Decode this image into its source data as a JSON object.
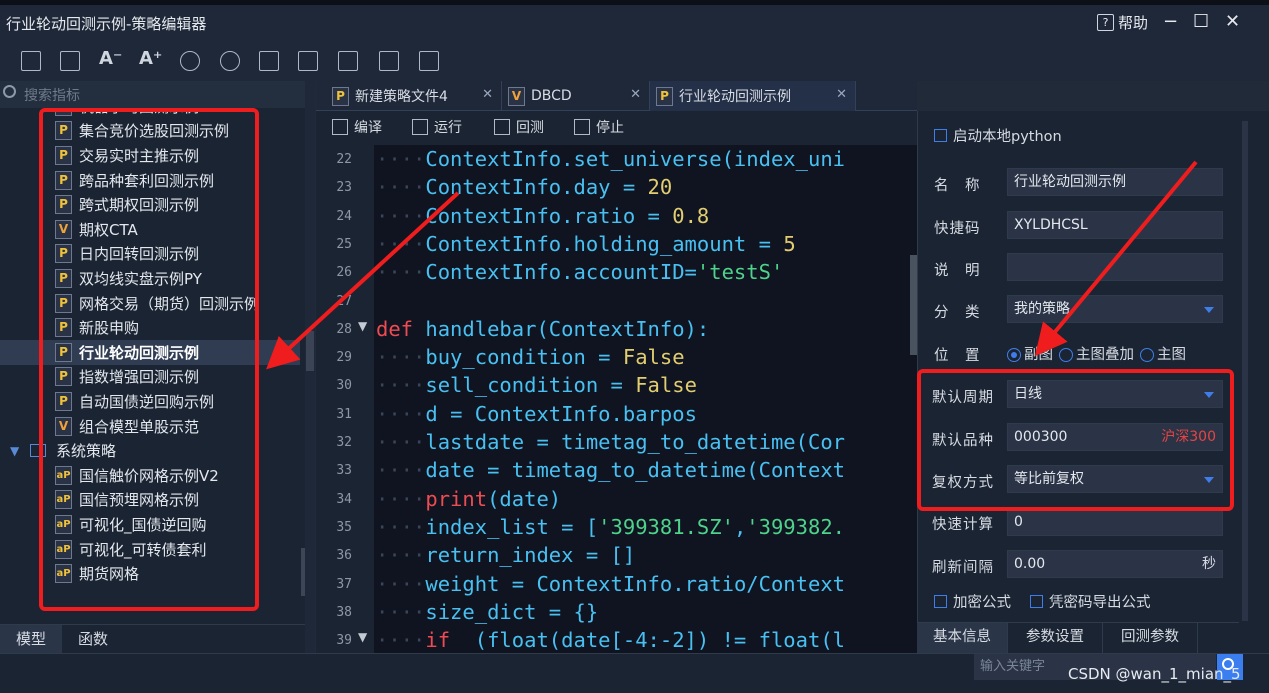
{
  "window": {
    "title": "行业轮动回测示例-策略编辑器",
    "help_icon_text": "?",
    "help_label": "帮助",
    "minimize": "−",
    "maximize": "☐",
    "close": "✕"
  },
  "toolbar": {
    "icons": [
      "save-icon",
      "save-all-icon",
      "font-decrease-icon",
      "font-increase-icon",
      "import-icon",
      "export-icon",
      "search-file-icon",
      "document-icon",
      "list-document-icon",
      "encrypt-icon",
      "decrypt-icon"
    ],
    "font_decrease": "A⁻",
    "font_increase": "A⁺"
  },
  "left": {
    "search_placeholder": "搜索指标",
    "items": [
      {
        "icon": "P",
        "label": "机器学习回测示例"
      },
      {
        "icon": "P",
        "label": "集合竞价选股回测示例"
      },
      {
        "icon": "P",
        "label": "交易实时主推示例"
      },
      {
        "icon": "P",
        "label": "跨品种套利回测示例"
      },
      {
        "icon": "P",
        "label": "跨式期权回测示例"
      },
      {
        "icon": "V",
        "label": "期权CTA"
      },
      {
        "icon": "P",
        "label": "日内回转回测示例"
      },
      {
        "icon": "P",
        "label": "双均线实盘示例PY"
      },
      {
        "icon": "P",
        "label": "网格交易（期货）回测示例"
      },
      {
        "icon": "P",
        "label": "新股申购"
      },
      {
        "icon": "P",
        "label": "行业轮动回测示例"
      },
      {
        "icon": "P",
        "label": "指数增强回测示例"
      },
      {
        "icon": "P",
        "label": "自动国债逆回购示例"
      },
      {
        "icon": "V",
        "label": "组合模型单股示范"
      }
    ],
    "folder": "系统策略",
    "folder_items": [
      {
        "icon": "aP",
        "label": "国信触价网格示例V2"
      },
      {
        "icon": "aP",
        "label": "国信预埋网格示例"
      },
      {
        "icon": "aP",
        "label": "可视化_国债逆回购"
      },
      {
        "icon": "aP",
        "label": "可视化_可转债套利"
      },
      {
        "icon": "aP",
        "label": "期货网格"
      }
    ],
    "tabs": [
      "模型",
      "函数"
    ]
  },
  "tabs": [
    {
      "icon": "P",
      "label": "新建策略文件4",
      "close": "✕"
    },
    {
      "icon": "V",
      "label": "DBCD",
      "close": "✕"
    },
    {
      "icon": "P",
      "label": "行业轮动回测示例",
      "close": "✕"
    }
  ],
  "code_toolbar": {
    "compile": "编译",
    "run": "运行",
    "backtest": "回测",
    "stop": "停止"
  },
  "code_lines": [
    {
      "n": "22",
      "html": "<span class='dot'>····</span>ContextInfo.set_universe(index_uni"
    },
    {
      "n": "23",
      "html": "<span class='dot'>····</span>ContextInfo.day <span class='op'>=</span> <span class='num'>20</span>"
    },
    {
      "n": "24",
      "html": "<span class='dot'>····</span>ContextInfo.ratio <span class='op'>=</span> <span class='num'>0.8</span>"
    },
    {
      "n": "25",
      "html": "<span class='dot'>····</span>ContextInfo.holding_amount <span class='op'>=</span> <span class='num'>5</span>"
    },
    {
      "n": "26",
      "html": "<span class='dot'>····</span>ContextInfo.accountID=<span class='str'>'testS'</span>"
    },
    {
      "n": "27",
      "html": ""
    },
    {
      "n": "28",
      "fold": "▼",
      "html": "<span class='kw'>def</span> handlebar(ContextInfo):"
    },
    {
      "n": "29",
      "html": "<span class='dot'>····</span>buy_condition <span class='op'>=</span> <span class='num'>False</span>"
    },
    {
      "n": "30",
      "html": "<span class='dot'>····</span>sell_condition <span class='op'>=</span> <span class='num'>False</span>"
    },
    {
      "n": "31",
      "html": "<span class='dot'>····</span>d <span class='op'>=</span> ContextInfo.barpos"
    },
    {
      "n": "32",
      "html": "<span class='dot'>····</span>lastdate <span class='op'>=</span> timetag_to_datetime(Cor"
    },
    {
      "n": "33",
      "html": "<span class='dot'>····</span>date <span class='op'>=</span> timetag_to_datetime(Context"
    },
    {
      "n": "34",
      "html": "<span class='dot'>····</span><span class='kw'>print</span>(date)"
    },
    {
      "n": "35",
      "html": "<span class='dot'>····</span>index_list <span class='op'>=</span> [<span class='str'>'399381.SZ'</span>,<span class='str'>'399382.</span>"
    },
    {
      "n": "36",
      "html": "<span class='dot'>····</span>return_index <span class='op'>=</span> []"
    },
    {
      "n": "37",
      "html": "<span class='dot'>····</span>weight <span class='op'>=</span> ContextInfo.ratio/Context"
    },
    {
      "n": "38",
      "html": "<span class='dot'>····</span>size_dict <span class='op'>=</span> {}"
    },
    {
      "n": "39",
      "fold": "▼",
      "html": "<span class='dot'>····</span><span class='kw'>if</span>  (float(date[-4:-2]) != float(l"
    }
  ],
  "right": {
    "local_python": "启动本地python",
    "name_label": "名　称",
    "name_value": "行业轮动回测示例",
    "shortcut_label": "快捷码",
    "shortcut_value": "XYLDHCSL",
    "desc_label": "说　明",
    "desc_value": "",
    "category_label": "分　类",
    "category_value": "我的策略",
    "position_label": "位　置",
    "pos_options": [
      "副图",
      "主图叠加",
      "主图"
    ],
    "period_label": "默认周期",
    "period_value": "日线",
    "variety_label": "默认品种",
    "variety_value": "000300",
    "variety_name": "沪深300",
    "adjust_label": "复权方式",
    "adjust_value": "等比前复权",
    "fastcalc_label": "快速计算",
    "fastcalc_value": "0",
    "refresh_label": "刷新间隔",
    "refresh_value": "0.00",
    "refresh_unit": "秒",
    "encrypt_formula": "加密公式",
    "export_formula": "凭密码导出公式",
    "tabs": [
      "基本信息",
      "参数设置",
      "回测参数"
    ]
  },
  "status": {
    "keyword_placeholder": "输入关键字",
    "watermark": "CSDN @wan_1_mian_5"
  }
}
